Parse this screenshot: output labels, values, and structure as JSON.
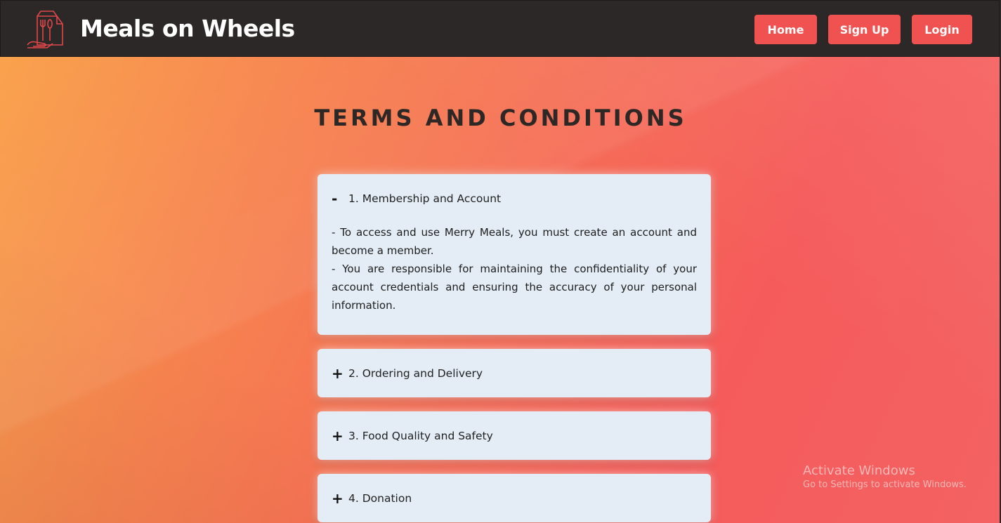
{
  "header": {
    "brand": "Meals on Wheels",
    "nav": {
      "home": "Home",
      "signup": "Sign Up",
      "login": "Login"
    }
  },
  "page": {
    "title": "TERMS AND CONDITIONS"
  },
  "accordion": [
    {
      "toggle": "-",
      "title": "1. Membership and Account",
      "expanded": true,
      "body": [
        "- To access and use Merry Meals, you must create an account and become a member.",
        "- You are responsible for maintaining the confidentiality of your account credentials and ensuring the accuracy of your personal information."
      ]
    },
    {
      "toggle": "+",
      "title": "2. Ordering and Delivery",
      "expanded": false
    },
    {
      "toggle": "+",
      "title": "3. Food Quality and Safety",
      "expanded": false
    },
    {
      "toggle": "+",
      "title": "4. Donation",
      "expanded": false
    }
  ],
  "watermark": {
    "title": "Activate Windows",
    "subtitle": "Go to Settings to activate Windows."
  },
  "colors": {
    "header_bg": "#2d2828",
    "button": "#f05252",
    "card_bg": "#e4edf6",
    "title_text": "#2d2826"
  }
}
